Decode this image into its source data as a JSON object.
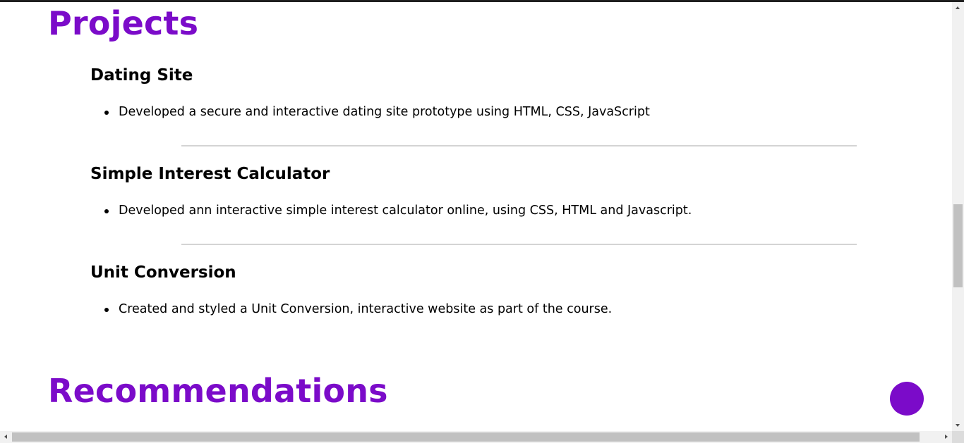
{
  "projects_section": {
    "title": "Projects",
    "items": [
      {
        "title": "Dating Site",
        "bullet": "Developed a secure and interactive dating site prototype using HTML, CSS, JavaScript"
      },
      {
        "title": "Simple Interest Calculator",
        "bullet": "Developed ann interactive simple interest calculator online, using CSS, HTML and Javascript."
      },
      {
        "title": "Unit Conversion",
        "bullet": "Created and styled a Unit Conversion, interactive website as part of the course."
      }
    ]
  },
  "recommendations_section": {
    "title": "Recommendations"
  },
  "colors": {
    "accent": "#7b0bc9",
    "divider": "#d4d4d4",
    "scrollbar_track": "#f1f1f1",
    "scrollbar_thumb": "#c1c1c1"
  }
}
